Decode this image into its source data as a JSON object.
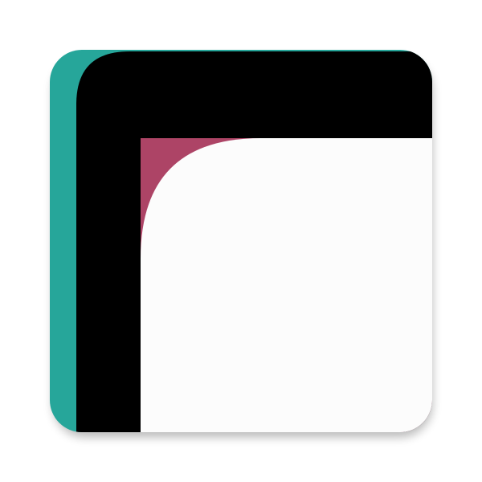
{
  "icon": {
    "name": "app-launcher-icon",
    "colors": {
      "teal": "#26a69a",
      "black": "#000000",
      "berry": "#ad4466",
      "white": "#fcfcfc",
      "shadow": "#000000"
    }
  }
}
